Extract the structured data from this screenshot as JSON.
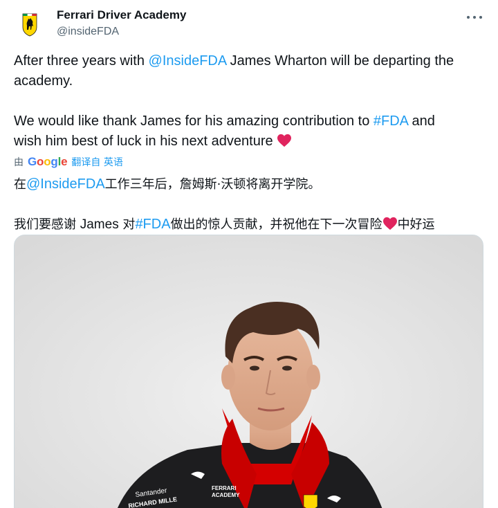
{
  "account": {
    "name": "Ferrari Driver Academy",
    "handle": "@insideFDA",
    "avatar_icon": "ferrari-prancing-horse-logo"
  },
  "tweet": {
    "line1_a": "After three years with ",
    "line1_mention": "@InsideFDA",
    "line1_b": " James Wharton will be departing the",
    "line2": "academy.",
    "line3_a": "We would like thank James for his amazing contribution to ",
    "line3_hashtag": "#FDA",
    "line3_b": " and",
    "line4": "wish him best of luck in his next adventure"
  },
  "translation": {
    "by": "由",
    "google": [
      "G",
      "o",
      "o",
      "g",
      "l",
      "e"
    ],
    "link": "翻译自 英语",
    "line1_a": "在",
    "line1_mention": "@InsideFDA",
    "line1_b": "工作三年后，詹姆斯·沃顿将离开学院。",
    "line2_a": "我们要感谢 ",
    "line2_name": "James",
    "line2_b": " 对",
    "line2_hashtag": "#FDA",
    "line2_c": "做出的惊人贡献，并祝他在下一次冒险",
    "line2_d": "中好运"
  },
  "colors": {
    "link": "#1d9bf0",
    "heart": "#e0245e",
    "secondary_text": "#536471",
    "ferrari_red": "#d40000",
    "ferrari_yellow": "#ffd700"
  },
  "media": {
    "content": "photo-driver-portrait",
    "suit_text_1": "FERRARI",
    "suit_text_2": "ACADEMY",
    "suit_sponsor_1": "Santander",
    "suit_sponsor_2": "RICHARD MILLE"
  }
}
